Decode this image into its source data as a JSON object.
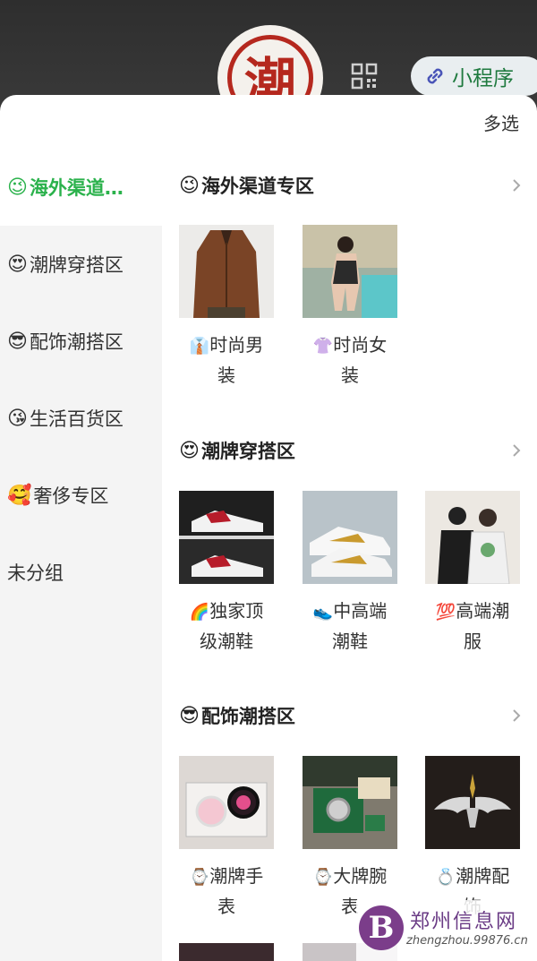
{
  "header": {
    "logo_char": "潮",
    "mini_program_label": "小程序",
    "qr_icon": "qr-code-icon",
    "link_icon": "link-icon"
  },
  "sheet": {
    "multi_select_label": "多选"
  },
  "sidebar": {
    "items": [
      {
        "emoji": "😉",
        "label": "海外渠道…",
        "active": true
      },
      {
        "emoji": "😍",
        "label": "潮牌穿搭区"
      },
      {
        "emoji": "😎",
        "label": "配饰潮搭区"
      },
      {
        "emoji": "😘",
        "label": "生活百货区"
      },
      {
        "emoji": "🥰",
        "label": "奢侈专区"
      },
      {
        "emoji": "",
        "label": "未分组"
      }
    ]
  },
  "sections": [
    {
      "emoji": "😉",
      "title": "海外渠道专区",
      "items": [
        {
          "icon": "👔",
          "line1": "时尚男",
          "line2": "装"
        },
        {
          "icon": "👚",
          "line1": "时尚女",
          "line2": "装"
        }
      ]
    },
    {
      "emoji": "😍",
      "title": "潮牌穿搭区",
      "items": [
        {
          "icon": "🌈",
          "line1": "独家顶",
          "line2": "级潮鞋"
        },
        {
          "icon": "👟",
          "line1": "中高端",
          "line2": "潮鞋"
        },
        {
          "icon": "💯",
          "line1": "高端潮",
          "line2": "服"
        }
      ]
    },
    {
      "emoji": "😎",
      "title": "配饰潮搭区",
      "items": [
        {
          "icon": "⌚",
          "line1": "潮牌手",
          "line2": "表"
        },
        {
          "icon": "⌚",
          "line1": "大牌腕",
          "line2": "表"
        },
        {
          "icon": "💍",
          "line1": "潮牌配",
          "line2": "饰"
        }
      ]
    }
  ],
  "watermark": {
    "badge": "B",
    "title": "郑州信息网",
    "url": "zhengzhou.99876.cn"
  },
  "colors": {
    "accent": "#2bb24c",
    "seal_red": "#b5281e"
  }
}
